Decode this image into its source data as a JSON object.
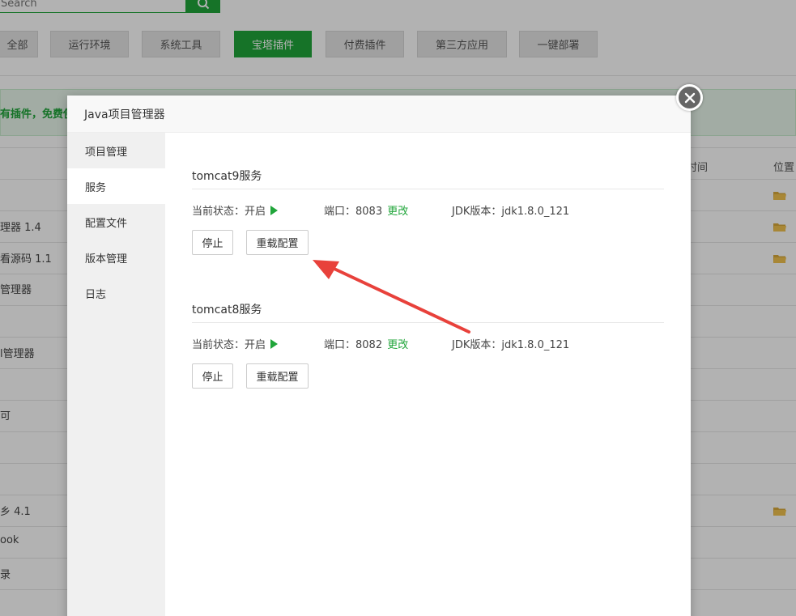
{
  "search": {
    "placeholder": "Search"
  },
  "categories": [
    {
      "label": "全部"
    },
    {
      "label": "运行环境"
    },
    {
      "label": "系统工具"
    },
    {
      "label": "宝塔插件"
    },
    {
      "label": "付费插件"
    },
    {
      "label": "第三方应用"
    },
    {
      "label": "一键部署"
    }
  ],
  "notice": "有插件，免费使",
  "table": {
    "headers": {
      "time": "时间",
      "location": "位置"
    },
    "rows": [
      {
        "text": ""
      },
      {
        "text": "理器 1.4"
      },
      {
        "text": "看源码 1.1"
      },
      {
        "text": "管理器"
      },
      {
        "text": ""
      },
      {
        "text": "l管理器"
      },
      {
        "text": ""
      },
      {
        "text": "可"
      },
      {
        "text": ""
      },
      {
        "text": ""
      },
      {
        "text": "乡 4.1"
      },
      {
        "text": "ook"
      },
      {
        "text": "录"
      }
    ]
  },
  "modal": {
    "title": "Java项目管理器",
    "sidebar": [
      {
        "label": "项目管理"
      },
      {
        "label": "服务"
      },
      {
        "label": "配置文件"
      },
      {
        "label": "版本管理"
      },
      {
        "label": "日志"
      }
    ],
    "services": [
      {
        "title": "tomcat9服务",
        "status_label": "当前状态：开启",
        "port_label": "端口：8083",
        "port_change": "更改",
        "jdk_label": "JDK版本：jdk1.8.0_121",
        "stop_label": "停止",
        "reload_label": "重载配置"
      },
      {
        "title": "tomcat8服务",
        "status_label": "当前状态：开启",
        "port_label": "端口：8082",
        "port_change": "更改",
        "jdk_label": "JDK版本：jdk1.8.0_121",
        "stop_label": "停止",
        "reload_label": "重载配置"
      }
    ]
  },
  "colors": {
    "brand_green": "#20a53a",
    "annotation_red": "#e8413b"
  }
}
